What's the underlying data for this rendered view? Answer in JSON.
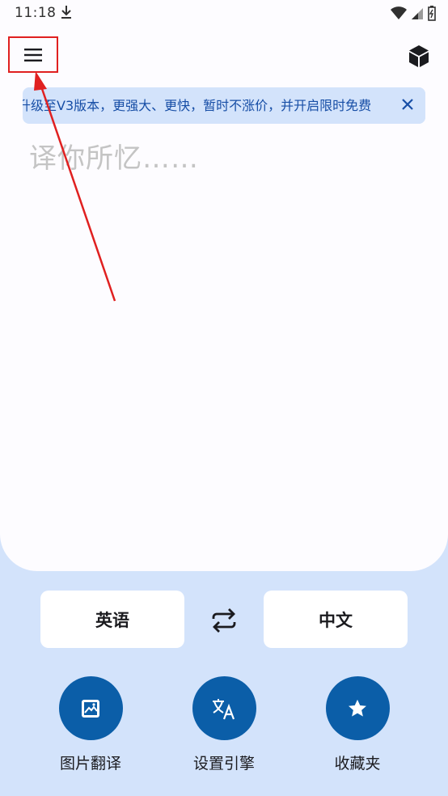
{
  "status_bar": {
    "time": "11:18"
  },
  "toolbar": {
    "menu_icon": "hamburger-menu-icon",
    "cube_icon": "cube-icon"
  },
  "banner": {
    "text": "升级至V3版本，更强大、更快，暂时不涨价，并开启限时免费",
    "close_icon": "close-icon"
  },
  "input": {
    "placeholder": "译你所忆……"
  },
  "languages": {
    "source": "英语",
    "target": "中文",
    "swap_icon": "swap-icon"
  },
  "actions": [
    {
      "label": "图片翻译",
      "icon": "image-icon"
    },
    {
      "label": "设置引擎",
      "icon": "translate-icon"
    },
    {
      "label": "收藏夹",
      "icon": "star-icon"
    }
  ],
  "colors": {
    "accent": "#0b5ea8",
    "background": "#d3e3fb",
    "panel": "#fdfcff",
    "annotation": "#e02020"
  }
}
